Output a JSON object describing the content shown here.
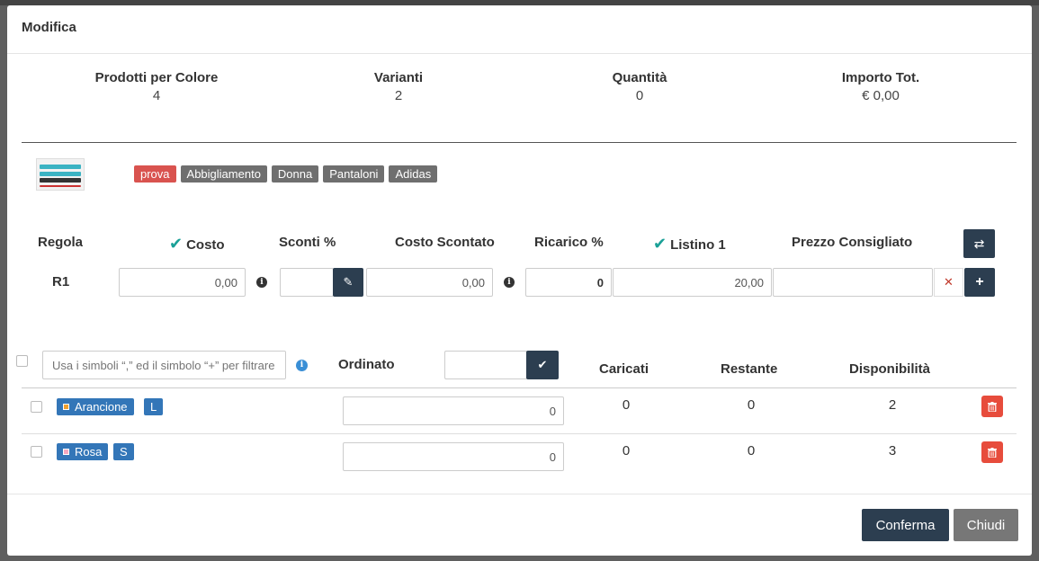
{
  "modal": {
    "title": "Modifica"
  },
  "stats": [
    {
      "label": "Prodotti per Colore",
      "value": "4"
    },
    {
      "label": "Varianti",
      "value": "2"
    },
    {
      "label": "Quantità",
      "value": "0"
    },
    {
      "label": "Importo Tot.",
      "value": "€ 0,00"
    }
  ],
  "tags": [
    {
      "label": "prova",
      "color": "#d9534f"
    },
    {
      "label": "Abbigliamento",
      "color": "#6f6f6f"
    },
    {
      "label": "Donna",
      "color": "#6f6f6f"
    },
    {
      "label": "Pantaloni",
      "color": "#6f6f6f"
    },
    {
      "label": "Adidas",
      "color": "#6f6f6f"
    }
  ],
  "pricing": {
    "headers": {
      "regola": "Regola",
      "costo": "Costo",
      "sconti": "Sconti %",
      "costo_scontato": "Costo Scontato",
      "ricarico": "Ricarico %",
      "listino": "Listino 1",
      "prezzo_consigliato": "Prezzo Consigliato"
    },
    "row": {
      "rule": "R1",
      "costo": "0,00",
      "sconti": "",
      "costo_scontato": "0,00",
      "ricarico": "0",
      "listino": "20,00",
      "prezzo_consigliato": ""
    }
  },
  "variants": {
    "search_placeholder": "Usa i simboli “,” ed il simbolo “+” per filtrare",
    "ordinato_label": "Ordinato",
    "ordinato_value": "",
    "headers": {
      "caricati": "Caricati",
      "restante": "Restante",
      "disponibilita": "Disponibilità"
    },
    "rows": [
      {
        "color": "Arancione",
        "swatch": "#f0a030",
        "size": "L",
        "ordinato": "0",
        "caricati": "0",
        "restante": "0",
        "disponibilita": "2"
      },
      {
        "color": "Rosa",
        "swatch": "#f4a8c0",
        "size": "S",
        "ordinato": "0",
        "caricati": "0",
        "restante": "0",
        "disponibilita": "3"
      }
    ]
  },
  "footer": {
    "confirm": "Conferma",
    "close": "Chiudi"
  },
  "colors": {
    "accent_dark": "#2c3e50",
    "check_green": "#1aa097",
    "danger": "#e74c3c",
    "tag_blue": "#3376b8"
  },
  "icons": [
    "check-icon",
    "info-icon",
    "pencil-icon",
    "swap-icon",
    "plus-icon",
    "close-icon",
    "trash-icon"
  ]
}
